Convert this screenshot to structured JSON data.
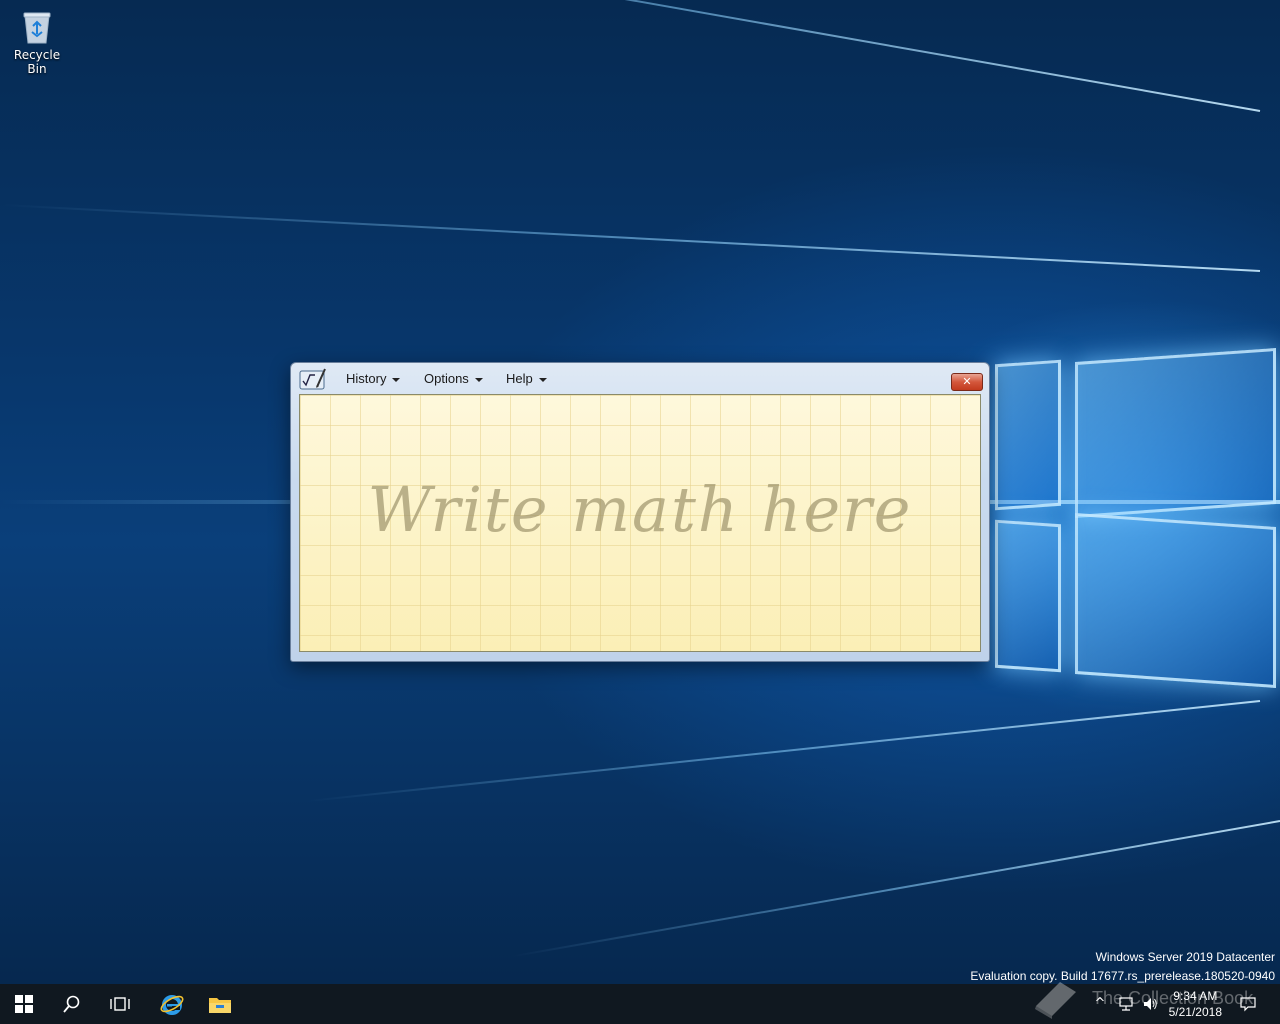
{
  "desktop": {
    "icons": [
      {
        "label": "Recycle Bin",
        "icon": "recycle-bin-icon"
      }
    ],
    "watermark": {
      "line1": "Windows Server 2019 Datacenter",
      "line2": "Evaluation copy. Build 17677.rs_prerelease.180520-0940"
    },
    "overlay_brand": "The Collection Book"
  },
  "window": {
    "app_icon": "math-input-panel-icon",
    "menus": [
      {
        "label": "History"
      },
      {
        "label": "Options"
      },
      {
        "label": "Help"
      }
    ],
    "close_label": "✕",
    "placeholder": "Write math here"
  },
  "taskbar": {
    "buttons": [
      {
        "icon": "windows-start-icon"
      },
      {
        "icon": "search-icon"
      },
      {
        "icon": "task-view-icon"
      },
      {
        "icon": "internet-explorer-icon"
      },
      {
        "icon": "file-explorer-icon"
      }
    ],
    "tray": {
      "time": "9:34 AM",
      "date": "5/21/2018",
      "icons": [
        "chevron-up-icon",
        "network-icon",
        "volume-icon",
        "notification-icon"
      ]
    }
  },
  "colors": {
    "accent": "#0a3f7a",
    "close_red": "#c23a1e",
    "pad_yellow": "#fdf3c4"
  }
}
